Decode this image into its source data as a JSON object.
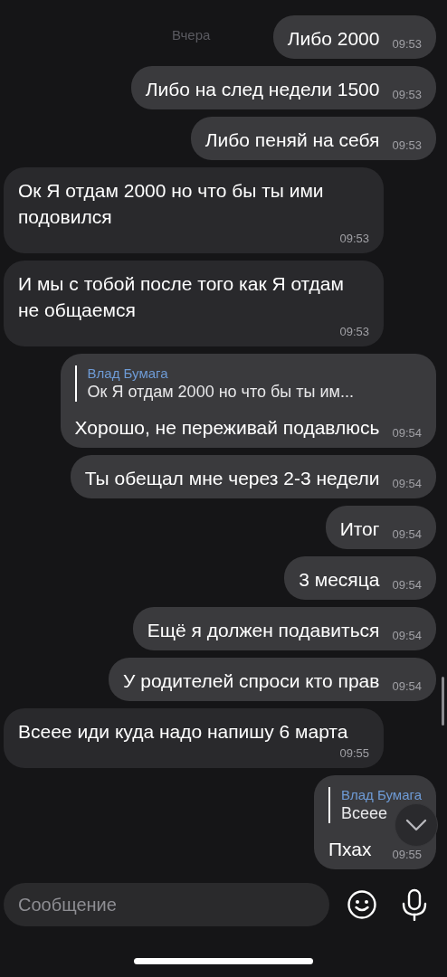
{
  "date_label": "Вчера",
  "messages": [
    {
      "outgoing": true,
      "text": "Либо 2000",
      "time": "09:53"
    },
    {
      "outgoing": true,
      "text": "Либо на след недели 1500",
      "time": "09:53"
    },
    {
      "outgoing": true,
      "text": "Либо пеняй на себя",
      "time": "09:53"
    },
    {
      "outgoing": false,
      "text": "Ок Я отдам 2000 но что бы ты ими подовился",
      "time": "09:53"
    },
    {
      "outgoing": false,
      "text": "И мы с тобой после того как Я отдам не общаемся",
      "time": "09:53"
    },
    {
      "outgoing": true,
      "reply": {
        "author": "Влад Бумага",
        "text": "Ок Я отдам 2000 но что бы ты им..."
      },
      "text": "Хорошо, не переживай подавлюсь",
      "time": "09:54"
    },
    {
      "outgoing": true,
      "text": "Ты обещал мне через 2-3 недели",
      "time": "09:54"
    },
    {
      "outgoing": true,
      "text": "Итог",
      "time": "09:54"
    },
    {
      "outgoing": true,
      "text": "3 месяца",
      "time": "09:54"
    },
    {
      "outgoing": true,
      "text": "Ещё я должен подавиться",
      "time": "09:54"
    },
    {
      "outgoing": true,
      "text": "У родителей спроси кто прав",
      "time": "09:54"
    },
    {
      "outgoing": false,
      "text": "Всеее иди куда надо напишу 6 марта",
      "time": "09:55"
    },
    {
      "outgoing": true,
      "reply": {
        "author": "Влад Бумага",
        "text": "Всеее"
      },
      "text": "Пхах",
      "time": "09:55"
    }
  ],
  "composer": {
    "placeholder": "Сообщение"
  }
}
